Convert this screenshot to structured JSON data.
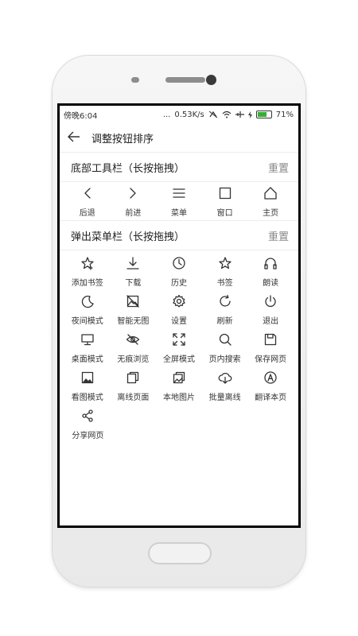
{
  "status_bar": {
    "time": "傍晚6:04",
    "dots": "...",
    "speed": "0.53K/s",
    "battery_percent": "71%",
    "battery_level": 0.71
  },
  "header": {
    "title": "调整按钮排序"
  },
  "bottom_toolbar": {
    "title": "底部工具栏（长按拖拽）",
    "reset_label": "重置",
    "items": [
      {
        "label": "后退",
        "icon": "back-chevron-icon"
      },
      {
        "label": "前进",
        "icon": "forward-chevron-icon"
      },
      {
        "label": "菜单",
        "icon": "menu-icon"
      },
      {
        "label": "窗口",
        "icon": "window-icon"
      },
      {
        "label": "主页",
        "icon": "home-icon"
      }
    ]
  },
  "popup_menu": {
    "title": "弹出菜单栏（长按拖拽）",
    "reset_label": "重置",
    "items": [
      {
        "label": "添加书签",
        "icon": "add-bookmark-icon"
      },
      {
        "label": "下载",
        "icon": "download-icon"
      },
      {
        "label": "历史",
        "icon": "history-icon"
      },
      {
        "label": "书签",
        "icon": "bookmark-icon"
      },
      {
        "label": "朗读",
        "icon": "headphones-icon"
      },
      {
        "label": "夜间模式",
        "icon": "moon-icon"
      },
      {
        "label": "智能无图",
        "icon": "no-image-icon"
      },
      {
        "label": "设置",
        "icon": "gear-icon"
      },
      {
        "label": "刷新",
        "icon": "refresh-icon"
      },
      {
        "label": "退出",
        "icon": "power-icon"
      },
      {
        "label": "桌面模式",
        "icon": "desktop-icon"
      },
      {
        "label": "无痕浏览",
        "icon": "incognito-eye-icon"
      },
      {
        "label": "全屏模式",
        "icon": "fullscreen-icon"
      },
      {
        "label": "页内搜索",
        "icon": "search-icon"
      },
      {
        "label": "保存网页",
        "icon": "save-icon"
      },
      {
        "label": "看图模式",
        "icon": "image-icon"
      },
      {
        "label": "离线页面",
        "icon": "offline-pages-icon"
      },
      {
        "label": "本地图片",
        "icon": "local-images-icon"
      },
      {
        "label": "批量离线",
        "icon": "cloud-download-icon"
      },
      {
        "label": "翻译本页",
        "icon": "translate-icon"
      },
      {
        "label": "分享网页",
        "icon": "share-icon"
      }
    ]
  }
}
